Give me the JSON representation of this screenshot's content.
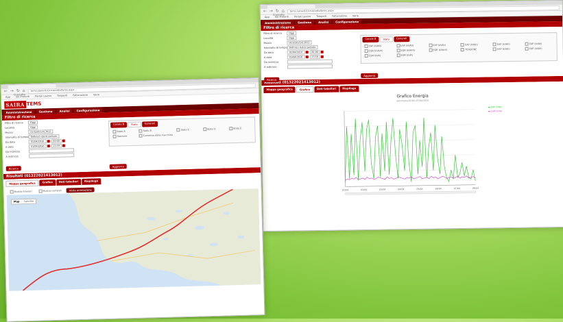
{
  "colors": {
    "brand_red": "#b00000",
    "menu_dark": "#6a0000",
    "series_green": "#36c936",
    "series_pink": "#d14fd1"
  },
  "front": {
    "tab_label": "Cruscotto",
    "url": "tems.saravit.it/cruscotto/tems.aspx",
    "bookmarks": [
      "App",
      "Siti Preferiti",
      "Portali Lavoro",
      "Trasporti",
      "Fatturazione",
      "Varie"
    ],
    "logo_box": "SAIRA",
    "logo_text": "TEMS",
    "menu": [
      "Amministrazione",
      "Gestione",
      "Analisi",
      "Configurazione"
    ],
    "filter_title": "Filtro di ricerca",
    "form": {
      "rows": [
        {
          "label": "Filtro di ricerca",
          "value": "Oggi"
        },
        {
          "label": "Località",
          "value": "Oggi"
        },
        {
          "label": "Mezzo",
          "value": "01322021413012"
        },
        {
          "label": "Intervallo di tempo",
          "value": "Definisci dal/al periodo"
        },
        {
          "label": "Da data",
          "value": "01/04/2016",
          "time": "00:00"
        },
        {
          "label": "A data",
          "value": "01/04/2016",
          "time": "23:59"
        },
        {
          "label": "Da indirizzo",
          "value": ""
        },
        {
          "label": "A indirizzo",
          "value": ""
        }
      ],
      "search_button": "Ricerca",
      "panel_tabs": [
        "Canale B",
        "Stato",
        "Generali"
      ],
      "checkboxes": [
        "Stato A",
        "Stato B",
        "Stato C",
        "Stato D",
        "Stato E",
        "Stazione",
        "Consenso dalla macchina"
      ],
      "update_button": "Aggiorna"
    },
    "results_title": "Risultati (01322021413012)",
    "result_tabs": [
      "Mappa geografica",
      "Grafico",
      "Dati tabellari",
      "Riepilogo"
    ],
    "map_options": [
      "Mostra itinerari",
      "Mostra comandi"
    ],
    "map_button": "Inizia animazione",
    "map_controls": [
      "Map",
      "Satellite"
    ]
  },
  "back": {
    "tab_label": "Cruscotto",
    "url": "tems.saravit.it/cruscotto/tems.aspx",
    "bookmarks": [
      "App",
      "Siti Preferiti",
      "Portali Lavoro",
      "Trasporti",
      "Fatturazione",
      "Varie"
    ],
    "menu": [
      "Amministrazione",
      "Gestione",
      "Analisi",
      "Configurazione"
    ],
    "filter_title": "Filtro di ricerca",
    "form": {
      "rows": [
        {
          "label": "Filtro di ricerca",
          "value": "Oggi"
        },
        {
          "label": "Località",
          "value": "Oggi"
        },
        {
          "label": "Mezzo",
          "value": "01322021413012"
        },
        {
          "label": "Intervallo di tempo",
          "value": "Definisci dal/al periodo"
        },
        {
          "label": "Da data",
          "value": "01/04/2016",
          "time": "00:00"
        },
        {
          "label": "A data",
          "value": "01/04/2016",
          "time": "23:59"
        },
        {
          "label": "Da indirizzo",
          "value": ""
        },
        {
          "label": "A indirizzo",
          "value": ""
        }
      ],
      "search_button": "Ricerca",
      "panel_tabs": [
        "Canale B",
        "Stato",
        "Generali"
      ],
      "checkboxes": [
        "EAP (kVAh)",
        "EAP (kVAh)",
        "EAP (kVAh)",
        "EAP (kVAh)",
        "EAP (kVAh)",
        "EAP (kVAh)",
        "EQR (kVArh)",
        "EQR (kVArh)",
        "EQR (kVArh)",
        "TENSIONE",
        "EAP (kVAh)",
        "EAP (kVAh)",
        "ESM (kVA)",
        "ESM (kVA)"
      ],
      "update_button": "Aggiorna"
    },
    "results_title": "Risultati (01322021413012)",
    "result_tabs": [
      "Mappa geografica",
      "Grafico",
      "Dati tabellari",
      "Riepilogo"
    ]
  },
  "chart_data": {
    "type": "line",
    "title": "Grafico Energia",
    "subtitle": "Settimana 01/04–07/04/2016",
    "legend": "top-right",
    "series": [
      {
        "name": "EAP (kWh)",
        "color": "#36c936",
        "values": [
          5,
          80,
          10,
          70,
          15,
          90,
          8,
          60,
          85,
          20,
          75,
          88,
          30,
          10,
          65,
          80,
          12,
          70,
          20,
          85,
          15,
          60,
          90,
          40,
          10,
          75,
          55,
          20,
          85,
          30,
          5,
          70,
          80,
          15,
          60,
          25,
          90,
          10,
          50,
          70,
          20,
          80,
          35,
          15,
          65,
          25,
          10,
          5,
          20,
          8,
          40,
          10,
          15,
          30,
          12,
          25,
          10,
          8,
          20,
          5
        ]
      },
      {
        "name": "ESM (kVA)",
        "color": "#d14fd1",
        "values": [
          8,
          10,
          9,
          11,
          10,
          12,
          9,
          10,
          11,
          9,
          12,
          10,
          11,
          9,
          10,
          12,
          11,
          10,
          9,
          12,
          10,
          11,
          9,
          10,
          12,
          11,
          10,
          9,
          11,
          10,
          12,
          9,
          10,
          11,
          12,
          9,
          10,
          11,
          9,
          12,
          10,
          11,
          9,
          10,
          12,
          11,
          9,
          10,
          11,
          9,
          10,
          12,
          9,
          11,
          10,
          12,
          9,
          10,
          11,
          9
        ]
      }
    ],
    "x_tick_labels": [
      "01/04",
      "02/04",
      "03/04",
      "04/04",
      "05/04",
      "06/04",
      "07/04",
      "08/04"
    ],
    "ylim": [
      0,
      100
    ],
    "grid": true
  }
}
